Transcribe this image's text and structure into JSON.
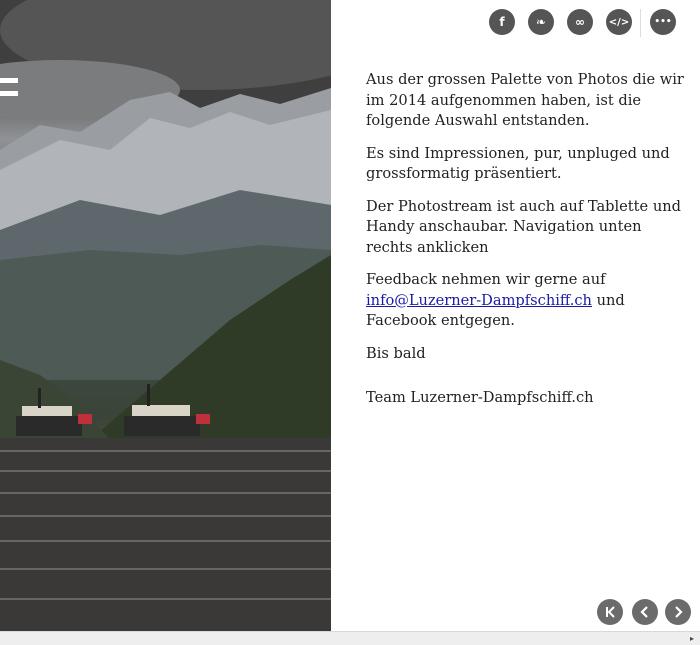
{
  "share_buttons": [
    {
      "name": "facebook-icon",
      "glyph": "f"
    },
    {
      "name": "twitter-icon",
      "glyph": "❧"
    },
    {
      "name": "link-icon",
      "glyph": "∞"
    },
    {
      "name": "embed-icon",
      "glyph": "</>"
    },
    {
      "name": "more-icon",
      "glyph": "•••"
    }
  ],
  "content": {
    "para1": "Aus der grossen Palette von Photos die wir im 2014 aufgenommen haben, ist die folgende Auswahl entstanden.",
    "para2": "Es sind Impressionen, pur, unpluged und grossformatig präsentiert.",
    "para3": "Der Photostream ist auch auf Tablette und Handy anschaubar.  Navigation unten rechts anklicken",
    "para4_before": "Feedback nehmen wir gerne auf ",
    "email_link": "info@Luzerner-Dampfschiff.ch",
    "para4_after": "  und Facebook entgegen.",
    "para5": "Bis bald",
    "signature": "Team Luzerner-Dampfschiff.ch"
  },
  "nav": {
    "first": "first-page-icon",
    "prev": "previous-icon",
    "next": "next-icon"
  },
  "colors": {
    "icon_bg": "#555555",
    "link": "#1a1aa6",
    "text": "#222222"
  }
}
